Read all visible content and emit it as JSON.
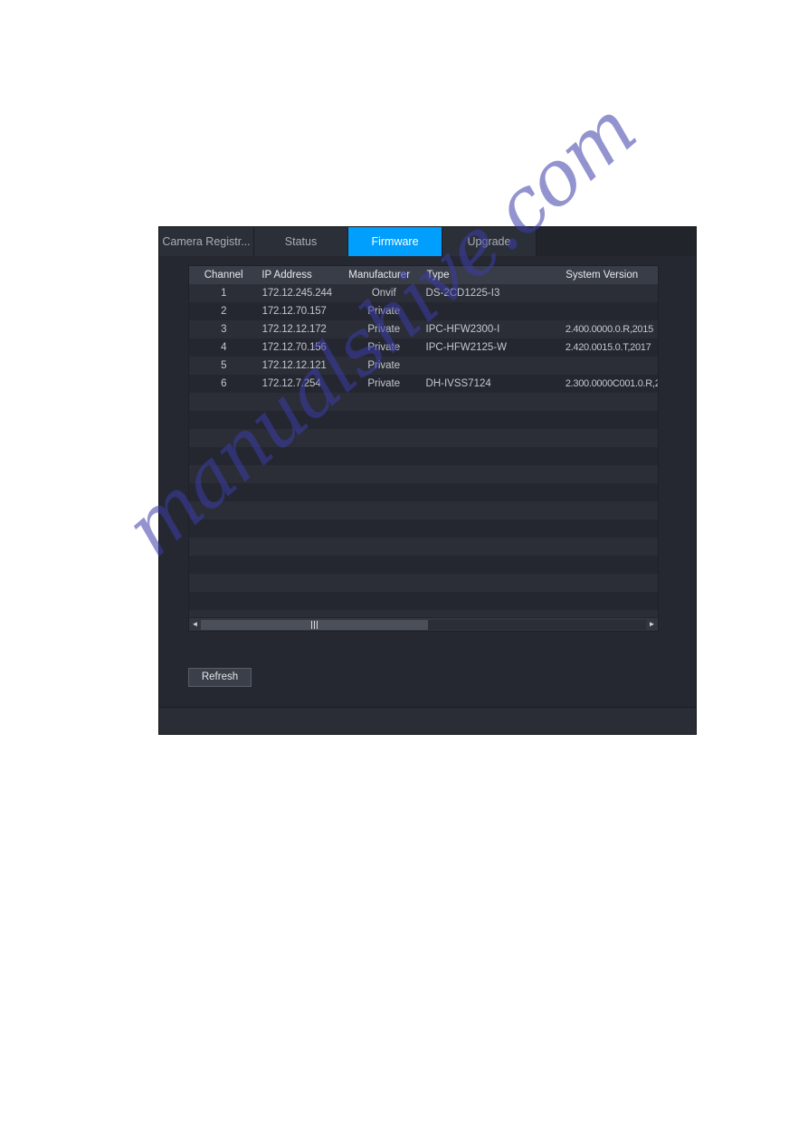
{
  "watermark": {
    "text": "manualshive.com"
  },
  "dialog": {
    "tabs": [
      {
        "label": "Camera Registr...",
        "active": false,
        "name": "tab-camera-registration"
      },
      {
        "label": "Status",
        "active": false,
        "name": "tab-status"
      },
      {
        "label": "Firmware",
        "active": true,
        "name": "tab-firmware"
      },
      {
        "label": "Upgrade",
        "active": false,
        "name": "tab-upgrade"
      }
    ],
    "accent_color": "#009ffd",
    "table": {
      "columns": [
        "Channel",
        "IP Address",
        "Manufacturer",
        "Type",
        "System Version"
      ],
      "rows": [
        {
          "channel": "1",
          "ip": "172.12.245.244",
          "manufacturer": "Onvif",
          "type": "DS-2CD1225-I3",
          "version": ""
        },
        {
          "channel": "2",
          "ip": "172.12.70.157",
          "manufacturer": "Private",
          "type": "",
          "version": ""
        },
        {
          "channel": "3",
          "ip": "172.12.12.172",
          "manufacturer": "Private",
          "type": "IPC-HFW2300-I",
          "version": "2.400.0000.0.R,2015"
        },
        {
          "channel": "4",
          "ip": "172.12.70.156",
          "manufacturer": "Private",
          "type": "IPC-HFW2125-W",
          "version": "2.420.0015.0.T,2017"
        },
        {
          "channel": "5",
          "ip": "172.12.12.121",
          "manufacturer": "Private",
          "type": "",
          "version": ""
        },
        {
          "channel": "6",
          "ip": "172.12.7.254",
          "manufacturer": "Private",
          "type": "DH-IVSS7124",
          "version": "2.300.0000C001.0.R,2"
        }
      ],
      "empty_row_count": 13
    },
    "scrollbar": {
      "left_arrow": "◄",
      "right_arrow": "►",
      "thumb_width_percent": 51
    },
    "refresh_button": {
      "label": "Refresh"
    }
  }
}
